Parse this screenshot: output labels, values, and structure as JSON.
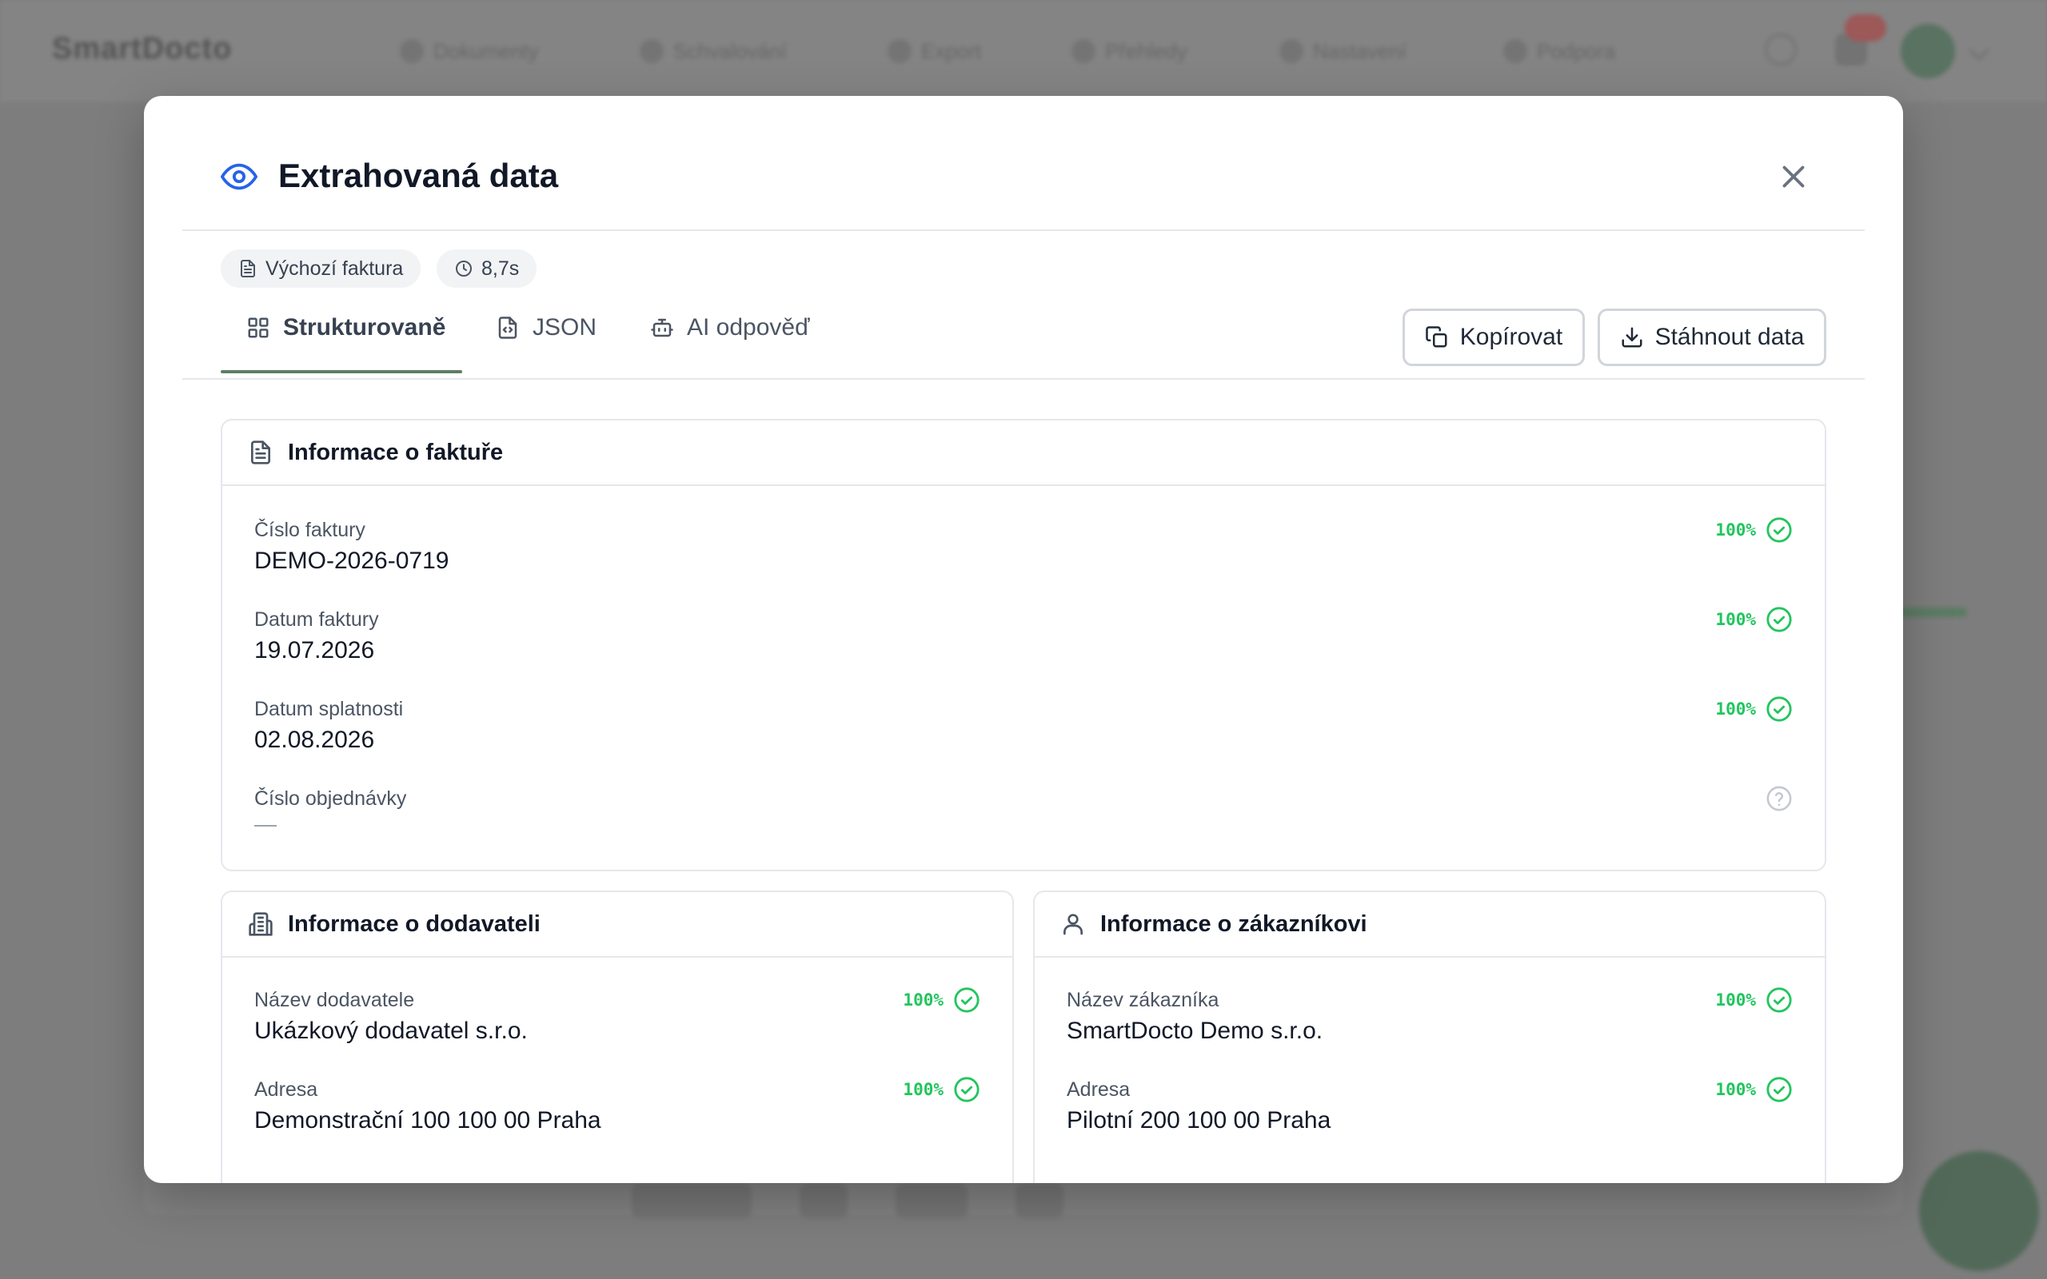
{
  "background": {
    "logo": "SmartDocto",
    "nav_items": [
      "Dokumenty",
      "Schvalování",
      "Export",
      "Přehledy",
      "Nastavení",
      "Podpora"
    ]
  },
  "modal": {
    "title": "Extrahovaná data",
    "chips": {
      "template": "Výchozí faktura",
      "duration": "8,7s"
    },
    "tabs": [
      {
        "label": "Strukturovaně",
        "active": true
      },
      {
        "label": "JSON",
        "active": false
      },
      {
        "label": "AI odpověď",
        "active": false
      }
    ],
    "actions": {
      "copy_label": "Kopírovat",
      "download_label": "Stáhnout data"
    },
    "sections": {
      "invoice": {
        "title": "Informace o faktuře",
        "fields": [
          {
            "label": "Číslo faktury",
            "value": "DEMO-2026-0719",
            "confidence": "100%"
          },
          {
            "label": "Datum faktury",
            "value": "19.07.2026",
            "confidence": "100%"
          },
          {
            "label": "Datum splatnosti",
            "value": "02.08.2026",
            "confidence": "100%"
          },
          {
            "label": "Číslo objednávky",
            "value": "",
            "confidence": ""
          }
        ]
      },
      "supplier": {
        "title": "Informace o dodavateli",
        "fields": [
          {
            "label": "Název dodavatele",
            "value": "Ukázkový dodavatel s.r.o.",
            "confidence": "100%"
          },
          {
            "label": "Adresa",
            "value": "Demonstrační 100 100 00 Praha",
            "confidence": "100%"
          }
        ]
      },
      "customer": {
        "title": "Informace o zákazníkovi",
        "fields": [
          {
            "label": "Název zákazníka",
            "value": "SmartDocto Demo s.r.o.",
            "confidence": "100%"
          },
          {
            "label": "Adresa",
            "value": "Pilotní 200 100 00 Praha",
            "confidence": "100%"
          }
        ]
      }
    }
  },
  "colors": {
    "accent": "#2563eb",
    "tab_underline": "#5e7e64",
    "confidence_ok": "#22c55e"
  }
}
